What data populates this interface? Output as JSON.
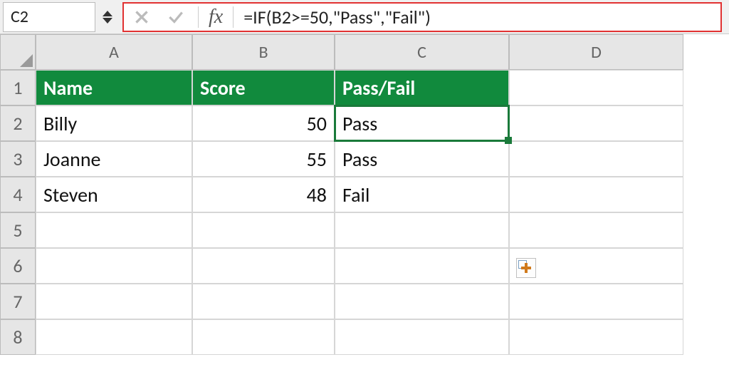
{
  "nameBox": "C2",
  "formula": "=IF(B2>=50,\"Pass\",\"Fail\")",
  "columns": [
    "A",
    "B",
    "C",
    "D"
  ],
  "rows": [
    "1",
    "2",
    "3",
    "4",
    "5",
    "6",
    "7",
    "8"
  ],
  "headers": {
    "A": "Name",
    "B": "Score",
    "C": "Pass/Fail"
  },
  "data": [
    {
      "name": "Billy",
      "score": "50",
      "result": "Pass"
    },
    {
      "name": "Joanne",
      "score": "55",
      "result": "Pass"
    },
    {
      "name": "Steven",
      "score": "48",
      "result": "Fail"
    }
  ],
  "selectedCell": "C2"
}
